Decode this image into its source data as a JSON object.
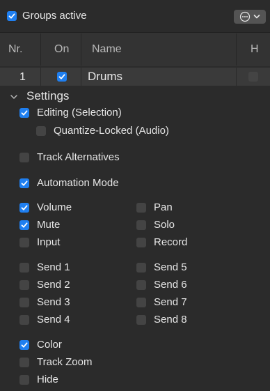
{
  "top": {
    "groups_active_checked": true,
    "groups_active_label": "Groups active"
  },
  "table": {
    "headers": {
      "nr": "Nr.",
      "on": "On",
      "name": "Name",
      "h": "H"
    },
    "row": {
      "nr": "1",
      "on": true,
      "name": "Drums",
      "h": false
    }
  },
  "settings": {
    "title": "Settings",
    "editing": {
      "label": "Editing (Selection)",
      "checked": true
    },
    "quantize": {
      "label": "Quantize-Locked (Audio)",
      "checked": false
    },
    "track_alternatives": {
      "label": "Track Alternatives",
      "checked": false
    },
    "automation_mode": {
      "label": "Automation Mode",
      "checked": true
    },
    "volume": {
      "label": "Volume",
      "checked": true
    },
    "pan": {
      "label": "Pan",
      "checked": false
    },
    "mute": {
      "label": "Mute",
      "checked": true
    },
    "solo": {
      "label": "Solo",
      "checked": false
    },
    "input": {
      "label": "Input",
      "checked": false
    },
    "record": {
      "label": "Record",
      "checked": false
    },
    "send1": {
      "label": "Send 1",
      "checked": false
    },
    "send5": {
      "label": "Send 5",
      "checked": false
    },
    "send2": {
      "label": "Send 2",
      "checked": false
    },
    "send6": {
      "label": "Send 6",
      "checked": false
    },
    "send3": {
      "label": "Send 3",
      "checked": false
    },
    "send7": {
      "label": "Send 7",
      "checked": false
    },
    "send4": {
      "label": "Send 4",
      "checked": false
    },
    "send8": {
      "label": "Send 8",
      "checked": false
    },
    "color": {
      "label": "Color",
      "checked": true
    },
    "track_zoom": {
      "label": "Track Zoom",
      "checked": false
    },
    "hide": {
      "label": "Hide",
      "checked": false
    }
  },
  "colors": {
    "accent": "#1f7ff0",
    "background": "#2b2b2b",
    "header": "#333333",
    "row": "#3a3a3a"
  },
  "icons": {
    "menu": "ellipsis-circle-icon",
    "dropdown": "chevron-down-icon",
    "disclosure": "chevron-down-icon",
    "check": "checkmark-icon"
  }
}
